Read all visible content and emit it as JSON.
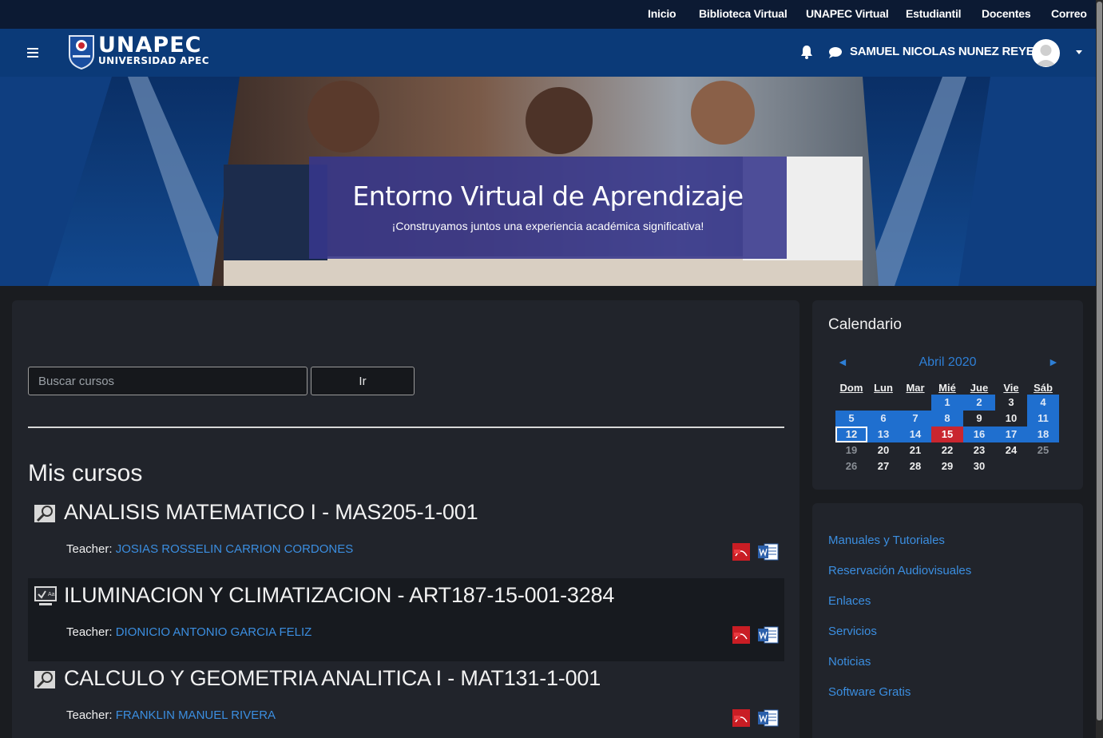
{
  "topnav": {
    "items": [
      "Inicio",
      "Biblioteca Virtual",
      "UNAPEC Virtual",
      "Estudiantil",
      "Docentes",
      "Correo"
    ]
  },
  "navbar": {
    "logo_main": "UNAPEC",
    "logo_sub": "UNIVERSIDAD APEC",
    "user_name": "SAMUEL NICOLAS NUNEZ REYES",
    "icons": [
      "menu-icon",
      "bell-icon",
      "chat-icon",
      "avatar",
      "chevron-down-icon"
    ]
  },
  "hero": {
    "title": "Entorno Virtual de Aprendizaje",
    "subtitle": "¡Construyamos juntos una experiencia académica significativa!"
  },
  "search": {
    "placeholder": "Buscar cursos",
    "button_label": "Ir"
  },
  "my_courses": {
    "heading": "Mis cursos",
    "teacher_label": "Teacher:",
    "courses": [
      {
        "title": "ANALISIS MATEMATICO I - MAS205-1-001",
        "teacher": "JOSIAS ROSSELIN CARRION CORDONES",
        "icon": "course-magnifier-icon"
      },
      {
        "title": "ILUMINACION Y CLIMATIZACION - ART187-15-001-3284",
        "teacher": "DIONICIO ANTONIO GARCIA FELIZ",
        "icon": "course-presentation-icon"
      },
      {
        "title": "CALCULO Y GEOMETRIA ANALITICA I - MAT131-1-001",
        "teacher": "FRANKLIN MANUEL RIVERA",
        "icon": "course-magnifier-icon"
      }
    ]
  },
  "calendar": {
    "title": "Calendario",
    "month": "Abril 2020",
    "prev": "◄",
    "next": "►",
    "weekdays": [
      "Dom",
      "Lun",
      "Mar",
      "Mié",
      "Jue",
      "Vie",
      "Sáb"
    ],
    "weeks": [
      [
        "",
        "",
        "",
        "1",
        "2",
        "3",
        "4"
      ],
      [
        "5",
        "6",
        "7",
        "8",
        "9",
        "10",
        "11"
      ],
      [
        "12",
        "13",
        "14",
        "15",
        "16",
        "17",
        "18"
      ],
      [
        "19",
        "20",
        "21",
        "22",
        "23",
        "24",
        "25"
      ],
      [
        "26",
        "27",
        "28",
        "29",
        "30",
        "",
        ""
      ]
    ],
    "today": "12",
    "highlight_red": "15",
    "colors": {
      "event": "#1f6fcf",
      "today_border": "#ffffff",
      "red": "#c9262f"
    }
  },
  "links": {
    "items": [
      "Manuales y Tutoriales",
      "Reservación Audiovisuales",
      "Enlaces",
      "Servicios",
      "Noticias",
      "Software Gratis"
    ]
  }
}
